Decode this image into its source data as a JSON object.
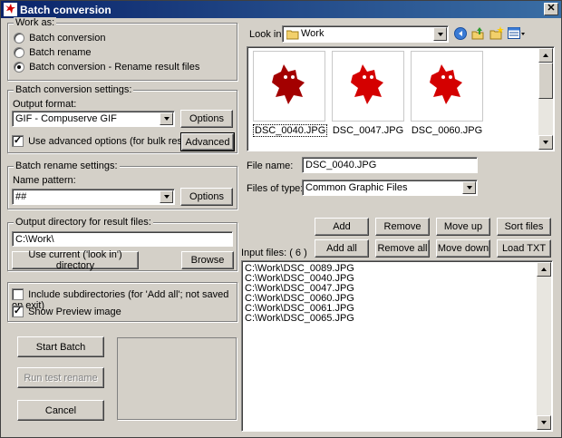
{
  "window": {
    "title": "Batch conversion"
  },
  "work_as": {
    "label": "Work as:",
    "options": [
      {
        "label": "Batch conversion",
        "selected": false
      },
      {
        "label": "Batch rename",
        "selected": false
      },
      {
        "label": "Batch conversion - Rename result files",
        "selected": true
      }
    ]
  },
  "conversion": {
    "label": "Batch conversion settings:",
    "format_label": "Output format:",
    "format_value": "GIF - Compuserve GIF",
    "options_button": "Options",
    "advanced_checkbox": "Use advanced options (for bulk resize...)",
    "advanced_checked": true,
    "advanced_button": "Advanced"
  },
  "rename": {
    "label": "Batch rename settings:",
    "pattern_label": "Name pattern:",
    "pattern_value": "##",
    "options_button": "Options"
  },
  "output": {
    "label": "Output directory for result files:",
    "directory_value": "C:\\Work\\",
    "use_current_button": "Use current ('look in') directory",
    "browse_button": "Browse"
  },
  "misc": {
    "subdirs_label": "Include subdirectories (for 'Add all'; not saved on exit)",
    "subdirs_checked": false,
    "preview_label": "Show Preview image",
    "preview_checked": true
  },
  "actions": {
    "start": "Start Batch",
    "test": "Run test rename",
    "cancel": "Cancel"
  },
  "browser": {
    "look_in_label": "Look in:",
    "look_in_value": "Work",
    "thumbnails": [
      {
        "name": "DSC_0040.JPG",
        "selected": true
      },
      {
        "name": "DSC_0047.JPG",
        "selected": false
      },
      {
        "name": "DSC_0060.JPG",
        "selected": false
      }
    ],
    "file_name_label": "File name:",
    "file_name_value": "DSC_0040.JPG",
    "file_type_label": "Files of type:",
    "file_type_value": "Common Graphic Files"
  },
  "list_buttons": {
    "add": "Add",
    "remove": "Remove",
    "move_up": "Move up",
    "sort": "Sort files",
    "add_all": "Add all",
    "remove_all": "Remove all",
    "move_down": "Move down",
    "load_txt": "Load TXT"
  },
  "input_files": {
    "label": "Input files: ( 6 )",
    "files": [
      "C:\\Work\\DSC_0089.JPG",
      "C:\\Work\\DSC_0040.JPG",
      "C:\\Work\\DSC_0047.JPG",
      "C:\\Work\\DSC_0060.JPG",
      "C:\\Work\\DSC_0061.JPG",
      "C:\\Work\\DSC_0065.JPG"
    ]
  },
  "icons": {
    "app": "irfanview-cat-icon",
    "folder": "folder-icon",
    "back": "back-arrow-icon",
    "up": "up-folder-icon",
    "new_folder": "new-folder-icon",
    "view": "view-menu-icon"
  },
  "colors": {
    "title_start": "#0a246a",
    "title_end": "#3a6ea5",
    "face": "#d4d0c8",
    "cat_red": "#d40000"
  }
}
